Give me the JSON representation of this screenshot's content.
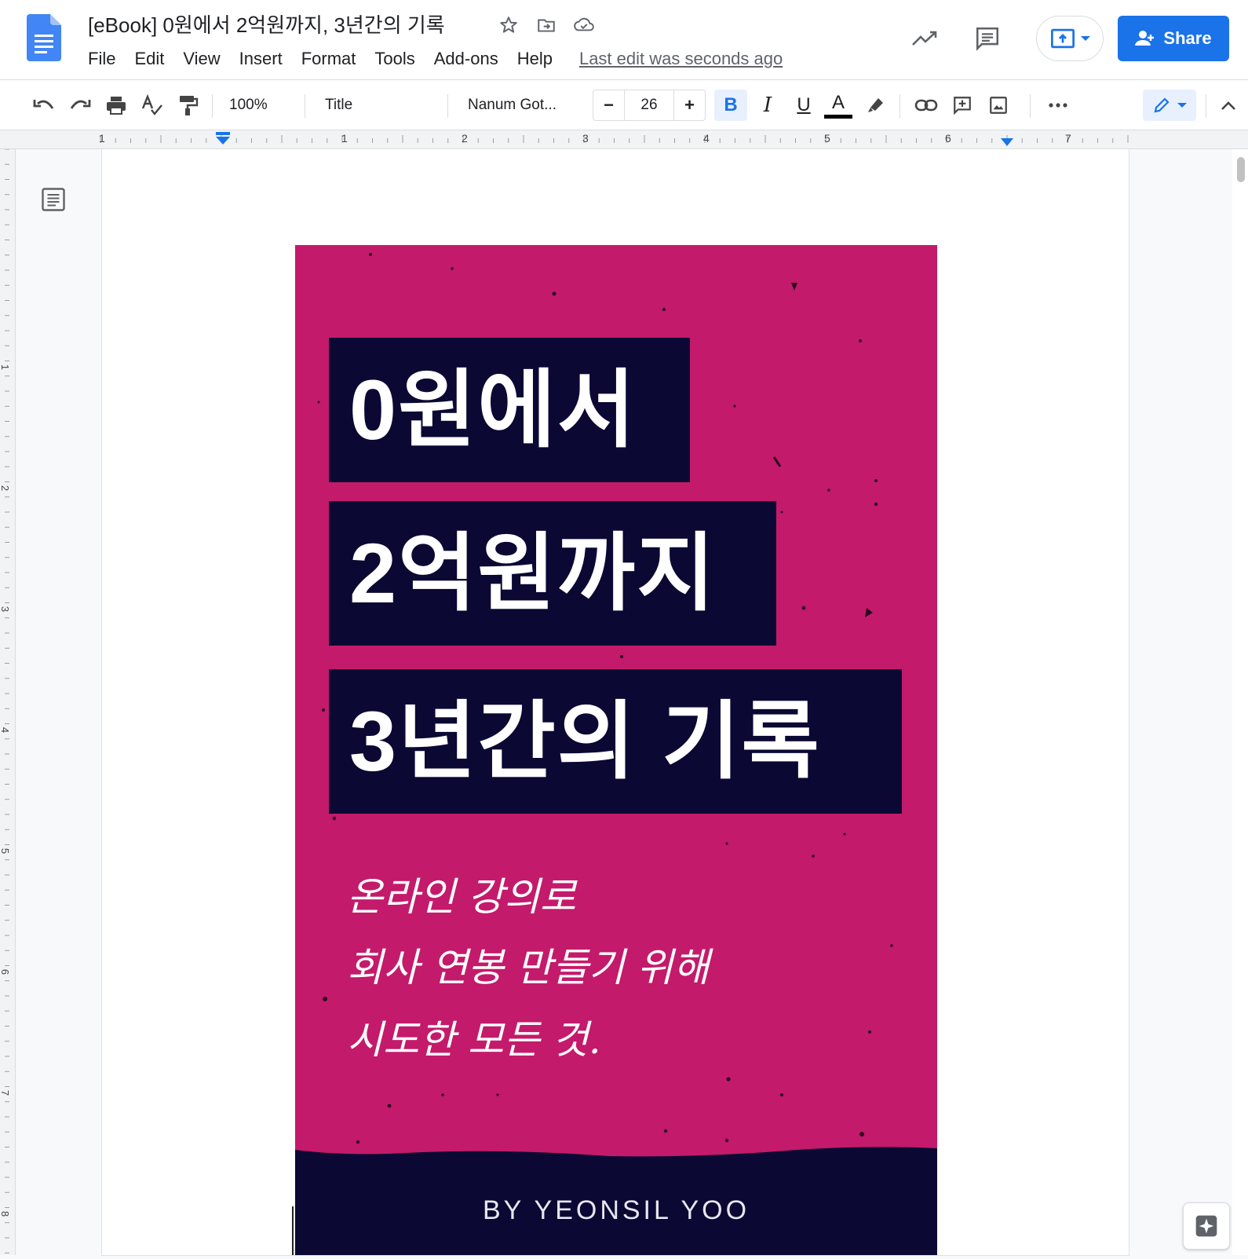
{
  "header": {
    "doc_title": "[eBook] 0원에서 2억원까지, 3년간의 기록",
    "menu": [
      "File",
      "Edit",
      "View",
      "Insert",
      "Format",
      "Tools",
      "Add-ons",
      "Help"
    ],
    "last_edit": "Last edit was seconds ago",
    "share_label": "Share"
  },
  "toolbar": {
    "zoom": "100%",
    "style": "Title",
    "font": "Nanum Got...",
    "font_size": "26",
    "bold": "B",
    "italic": "I",
    "underline": "U",
    "text_color": "A",
    "minus": "−",
    "plus": "+"
  },
  "ruler": {
    "h_labels": [
      "1",
      "1",
      "2",
      "3",
      "4",
      "5",
      "6",
      "7"
    ],
    "v_labels": [
      "1",
      "2",
      "3",
      "4",
      "5",
      "6",
      "7",
      "8"
    ]
  },
  "cover": {
    "title_lines": [
      "0원에서",
      "2억원까지",
      "3년간의 기록"
    ],
    "subtitle_lines": [
      "온라인 강의로",
      "회사 연봉 만들기 위해",
      "시도한 모든 것."
    ],
    "author": "BY YEONSIL YOO",
    "colors": {
      "background": "#c41a6b",
      "title_box": "#0b0933",
      "footer": "#0b0933"
    }
  },
  "icons": {
    "doc_logo": "docs-logo-icon",
    "star": "star-icon",
    "move": "move-to-folder-icon",
    "cloud": "cloud-saved-icon",
    "activity": "activity-trend-icon",
    "comments": "comments-icon",
    "present": "present-icon",
    "share": "person-add-icon"
  },
  "colors": {
    "accent": "#1a73e8"
  }
}
